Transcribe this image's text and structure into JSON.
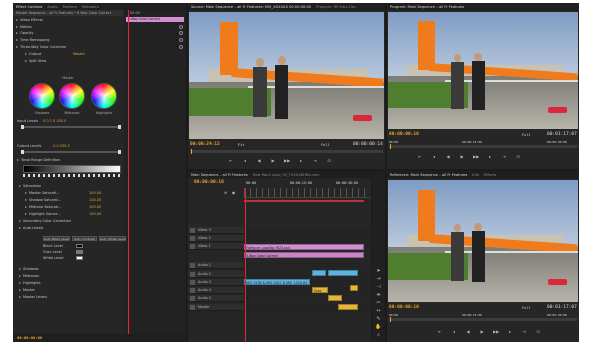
{
  "effect_controls": {
    "tabs": [
      "Effect Controls",
      "Audio",
      "Markers",
      "Metadata"
    ],
    "sequence_label": "Master Sequence – all Fr Features • 8 Way Color Correct",
    "timecode_head": "00:00",
    "clip_label": "3-Way Color Correct",
    "rows": [
      {
        "label": "Video Effects",
        "value": "",
        "value2": ""
      },
      {
        "label": "Motion",
        "value": "",
        "value2": ""
      },
      {
        "label": "Opacity",
        "value": "",
        "value2": ""
      },
      {
        "label": "Time Remapping",
        "value": "",
        "value2": ""
      },
      {
        "label": "Three-Way Color Corrector",
        "value": "",
        "value2": ""
      },
      {
        "label": "Output",
        "value": "Master",
        "value2": ""
      },
      {
        "label": "Split View",
        "value": "",
        "value2": ""
      }
    ],
    "wheels": [
      "Shadows",
      "Midtones",
      "Highlights"
    ],
    "wheels_title": "Master",
    "input_levels_label": "Input Levels",
    "input_levels": "0.0   1.0   255.0",
    "output_levels_label": "Output Levels",
    "output_levels": "0.0   255.0",
    "tonal_label": "Tonal Range Definition",
    "rows2": [
      {
        "label": "Saturation",
        "value": "",
        "value2": ""
      },
      {
        "label": "Master Saturati...",
        "value": "",
        "value2": "100.00"
      },
      {
        "label": "Shadow Saturati...",
        "value": "",
        "value2": "100.00"
      },
      {
        "label": "Midtone Saturati...",
        "value": "",
        "value2": "100.00"
      },
      {
        "label": "Highlight Satura...",
        "value": "",
        "value2": "100.00"
      },
      {
        "label": "Secondary Color Correction",
        "value": "",
        "value2": ""
      },
      {
        "label": "Auto Levels",
        "value": "",
        "value2": ""
      }
    ],
    "auto_buttons": [
      "Auto Black Level",
      "Auto Contrast",
      "Auto White Level"
    ],
    "levels": [
      "Black Level",
      "Gray Level",
      "White Level"
    ],
    "rows3": [
      "Shadows",
      "Midtones",
      "Highlights",
      "Master",
      "Master Levels"
    ],
    "footer_timecode": "00:00:00:00"
  },
  "source_monitor": {
    "tab": "Source: Main Sequence – all Fr Features: MVI_XXXXXX 00:00:00:00",
    "tab2": "Program: Rif Intro Dev",
    "timecode_left": "00:00:24:12",
    "timecode_right": "00:00:00:14",
    "fit": "Fit",
    "full": "Full"
  },
  "program_monitor": {
    "tab": "Program: Main Sequence – all Fr Features",
    "timecode_left": "00:00:00:10",
    "timecode_right": "00:01:17:07",
    "sub_left": "00:00",
    "sub_mid": "00:00:15:00",
    "sub_right": "00:00:30:00",
    "full": "Full"
  },
  "reference_monitor": {
    "tab": "Reference: Main Sequence – all Fr Features",
    "tab2": "Info",
    "tab3": "Effects",
    "timecode_left": "00:00:00:10",
    "timecode_right": "00:01:17:07",
    "sub_left": "00:00",
    "sub_mid": "00:00:15:00",
    "sub_right": "00:00:30:00",
    "full": "Full"
  },
  "timeline": {
    "tabs": [
      "Main Sequence – all Fr Features",
      "New Work Logo_00_TXVXX8H64.mov"
    ],
    "timecode": "00:00:00:10",
    "ruler": [
      "00:00",
      "00:00:15:00",
      "00:00:30:00"
    ],
    "tracks": [
      {
        "name": "Video 3"
      },
      {
        "name": "Video 2"
      },
      {
        "name": "Video 1"
      },
      {
        "name": "Audio 1"
      },
      {
        "name": "Audio 2"
      },
      {
        "name": "Audio 3"
      },
      {
        "name": "Audio 4"
      },
      {
        "name": "Audio 5"
      },
      {
        "name": "Master"
      }
    ],
    "clips": {
      "v3": "FixMovie_LogoTag_HD3.psd",
      "v2": "3-Way Color Correct",
      "v1": "MVI_0138 & MVI_0327 & MVI_1518 #1",
      "a_small": "Grey"
    }
  },
  "colors": {
    "orange_tc": "#e8a52c",
    "clip_pink": "#d38fd0",
    "clip_blue": "#5fb4de",
    "clip_audio": "#e5b53a"
  }
}
